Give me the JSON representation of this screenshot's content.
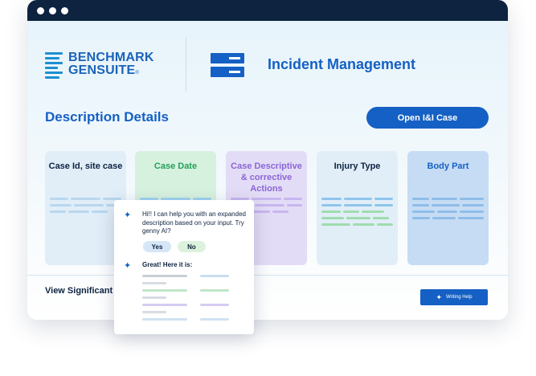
{
  "window": {
    "controls": [
      "dot",
      "dot",
      "dot"
    ]
  },
  "brand": {
    "line1": "BENCHMARK",
    "line2": "GENSUITE",
    "mark": "®"
  },
  "module": {
    "title": "Incident Management",
    "icon": "module-icon"
  },
  "section": {
    "title": "Description Details",
    "open_button": "Open I&I Case"
  },
  "cards": [
    {
      "title": "Case Id, site case",
      "bg": "#e1eef8",
      "title_color": "#0d2340",
      "line_color": "#b9d7ee"
    },
    {
      "title": "Case Date",
      "bg": "#d7f1df",
      "title_color": "#23a15a",
      "line_color": "#9fd3f2"
    },
    {
      "title": "Case Descriptive & corrective Actions",
      "bg": "#e3dcf6",
      "title_color": "#8a66d6",
      "line_color": "#c7b6f0"
    },
    {
      "title": "Injury Type",
      "bg": "#e1eef8",
      "title_color": "#0d2340",
      "line_color": "#8fc5ec"
    },
    {
      "title": "Body Part",
      "bg": "#c6dcf4",
      "title_color": "#1560c4",
      "line_color": "#8fbde9"
    }
  ],
  "footer": {
    "text": "View Significant",
    "writing_help": "Writing Help"
  },
  "popup": {
    "message": "Hi!! I can help you with an expanded description based on your input. Try genny AI?",
    "yes": "Yes",
    "no": "No",
    "reply": "Great! Here it is:"
  },
  "colors": {
    "accent": "#1560c4",
    "titlebar": "#0d2340"
  }
}
